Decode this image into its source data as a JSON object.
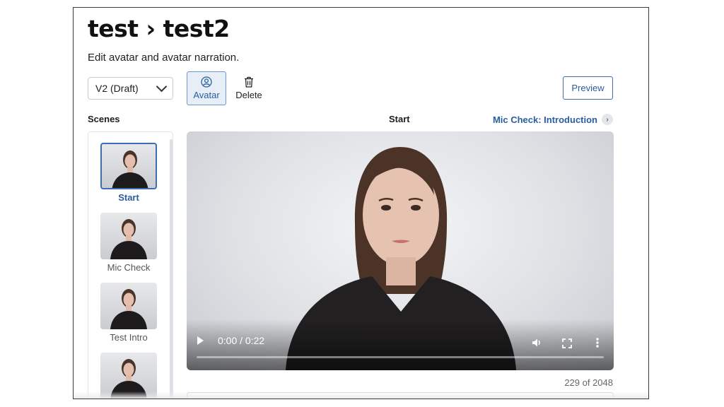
{
  "header": {
    "title": "test › test2",
    "subtitle": "Edit avatar and avatar narration."
  },
  "toolbar": {
    "version_select": "V2 (Draft)",
    "avatar_label": "Avatar",
    "delete_label": "Delete",
    "preview_label": "Preview"
  },
  "scenes": {
    "label": "Scenes",
    "items": [
      {
        "label": "Start",
        "selected": true
      },
      {
        "label": "Mic Check",
        "selected": false
      },
      {
        "label": "Test Intro",
        "selected": false
      },
      {
        "label": "",
        "selected": false
      }
    ]
  },
  "editor": {
    "current_scene": "Start",
    "next_scene_link": "Mic Check: Introduction",
    "video_time": "0:00 / 0:22",
    "video_progress": 0,
    "char_count": "229 of 2048"
  },
  "colors": {
    "accent": "#2a5d9f",
    "active_bg": "#e7eef8",
    "border": "#c9cdd3"
  }
}
